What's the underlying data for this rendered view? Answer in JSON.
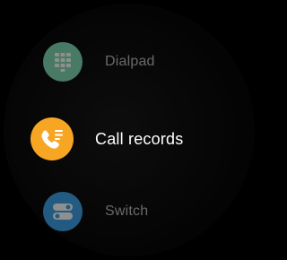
{
  "menu": {
    "items": [
      {
        "label": "Dialpad",
        "icon": "dialpad-icon",
        "color": "#7ed8b3",
        "selected": false
      },
      {
        "label": "Call records",
        "icon": "call-records-icon",
        "color": "#f6a623",
        "selected": true
      },
      {
        "label": "Switch",
        "icon": "switch-icon",
        "color": "#3aa0e8",
        "selected": false
      }
    ]
  }
}
